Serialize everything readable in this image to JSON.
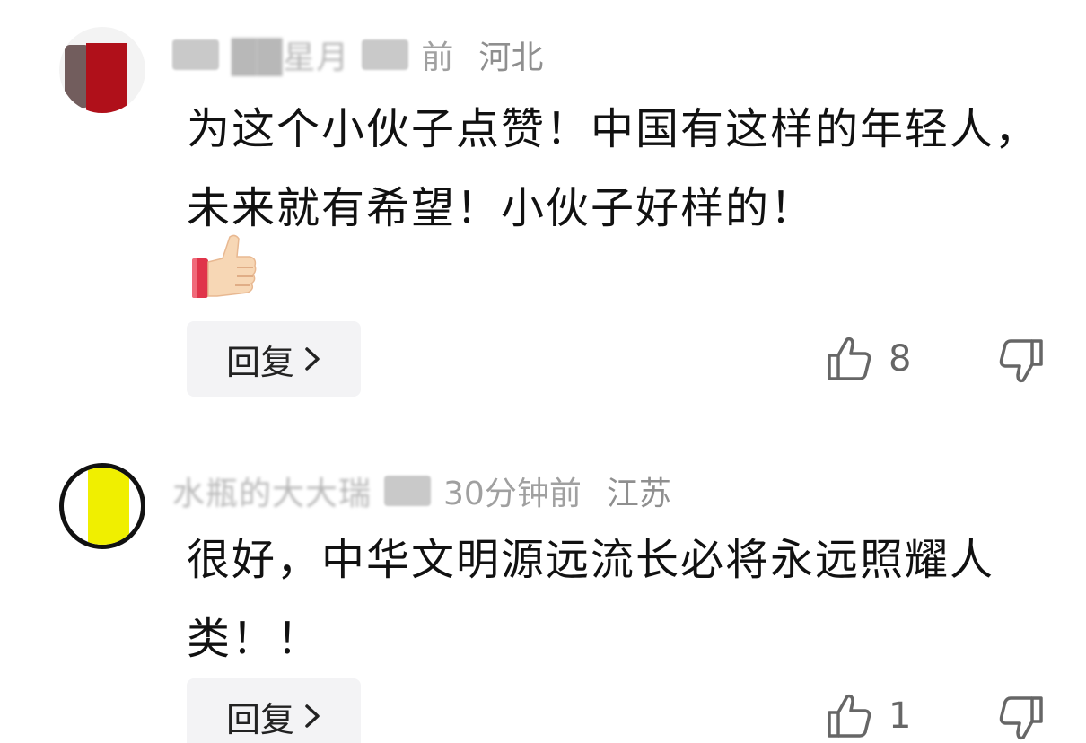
{
  "comments": [
    {
      "author": "██星月",
      "time": "前",
      "location": "河北",
      "text": "为这个小伙子点赞！中国有这样的年轻人，未来就有希望！小伙子好样的！",
      "emoji": "thumbs-up",
      "reply_label": "回复",
      "likes": "8"
    },
    {
      "author": "水瓶的大大瑞",
      "time": "30分钟前",
      "location": "江苏",
      "text": "很好，中华文明源远流长必将永远照耀人类！！",
      "reply_label": "回复",
      "likes": "1"
    }
  ],
  "icons": {
    "reply_chevron": "chevron-right-icon",
    "like": "thumbs-up-outline-icon",
    "dislike": "thumbs-down-outline-icon"
  },
  "colors": {
    "text": "#111111",
    "meta": "#9a9a9a",
    "icon": "#666666",
    "reply_bg": "#f3f3f5"
  }
}
